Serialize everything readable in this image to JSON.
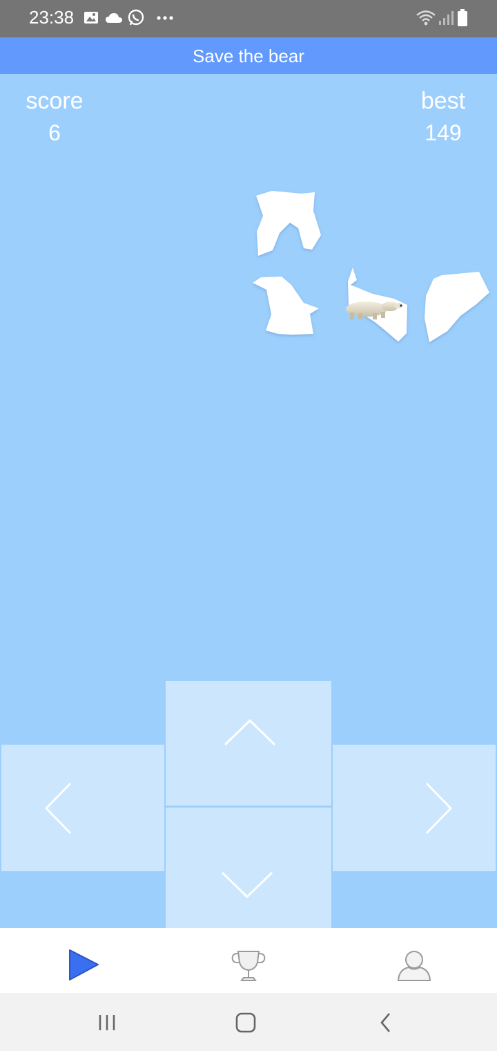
{
  "status_bar": {
    "time": "23:38",
    "left_icons": [
      "image-icon",
      "cloud-icon",
      "whatsapp-icon",
      "more-dots-icon"
    ],
    "right_icons": [
      "wifi-icon",
      "signal-icon",
      "battery-icon"
    ]
  },
  "app_bar": {
    "title": "Save the bear"
  },
  "game": {
    "score_label": "score",
    "score_value": "6",
    "best_label": "best",
    "best_value": "149",
    "colors": {
      "background": "#9dcffd",
      "ice": "#ffffff",
      "pad": "#cce6fd"
    }
  },
  "dpad": {
    "up_icon": "chevron-up-icon",
    "down_icon": "chevron-down-icon",
    "left_icon": "chevron-left-icon",
    "right_icon": "chevron-right-icon"
  },
  "bottom_nav": {
    "tabs": [
      {
        "icon": "play-icon",
        "active": true
      },
      {
        "icon": "trophy-icon",
        "active": false
      },
      {
        "icon": "profile-icon",
        "active": false
      }
    ],
    "active_color": "#3a6ff0"
  },
  "system_nav": {
    "buttons": [
      "recents-icon",
      "home-icon",
      "back-icon"
    ]
  }
}
